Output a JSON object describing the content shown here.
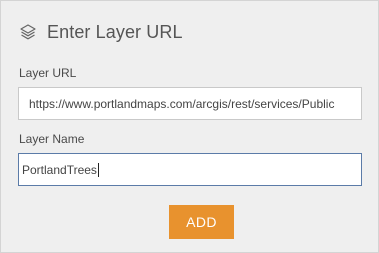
{
  "dialog": {
    "title": "Enter Layer URL",
    "title_icon": "layers-icon"
  },
  "layer_url": {
    "label": "Layer URL",
    "value": "https://www.portlandmaps.com/arcgis/rest/services/Public"
  },
  "layer_name": {
    "label": "Layer Name",
    "value": "PortlandTrees"
  },
  "actions": {
    "add_label": "ADD"
  },
  "colors": {
    "panel_background": "#efefef",
    "accent_button": "#e8922e",
    "focused_border": "#5b7ba8"
  }
}
